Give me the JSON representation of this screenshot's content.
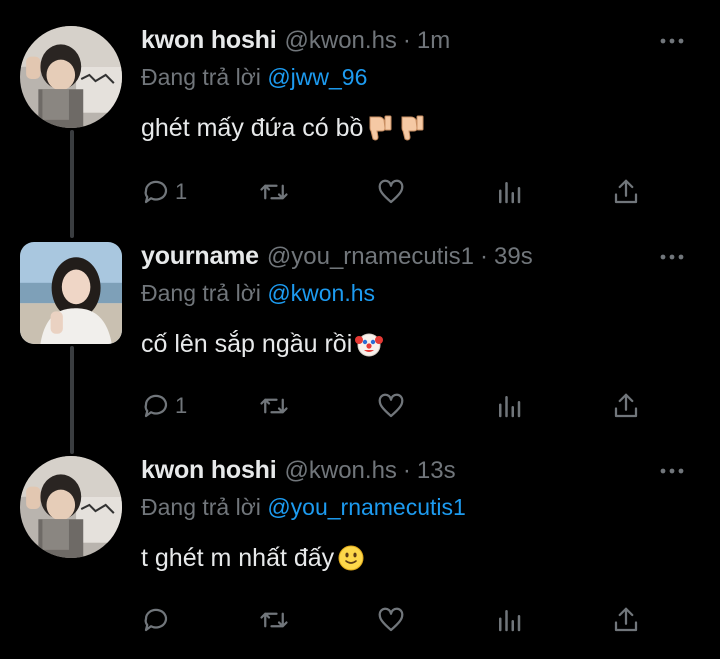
{
  "reply_prefix": "Đang trả lời",
  "tweets": [
    {
      "name": "kwon hoshi",
      "handle": "@kwon.hs",
      "time": "1m",
      "reply_to": "@jww_96",
      "text": "ghét mấy đứa có bồ",
      "emojis": [
        "thumbs-down",
        "thumbs-down"
      ],
      "reply_count": "1"
    },
    {
      "name": "yourname",
      "handle": "@you_rnamecutis1",
      "time": "39s",
      "reply_to": "@kwon.hs",
      "text": "cố lên sắp ngầu rồi",
      "emojis": [
        "clown-face"
      ],
      "reply_count": "1"
    },
    {
      "name": "kwon hoshi",
      "handle": "@kwon.hs",
      "time": "13s",
      "reply_to": "@you_rnamecutis1",
      "text": "t ghét m nhất đấy",
      "emojis": [
        "slightly-smiling-face"
      ],
      "reply_count": ""
    }
  ],
  "icons": {
    "reply": "reply-icon",
    "retweet": "retweet-icon",
    "like": "heart-icon",
    "analytics": "analytics-icon",
    "share": "share-icon",
    "more": "more-icon"
  },
  "colors": {
    "background": "#000000",
    "text": "#e7e9ea",
    "muted": "#71767b",
    "link": "#1d9bf0",
    "thread_line": "#3a3d40"
  }
}
